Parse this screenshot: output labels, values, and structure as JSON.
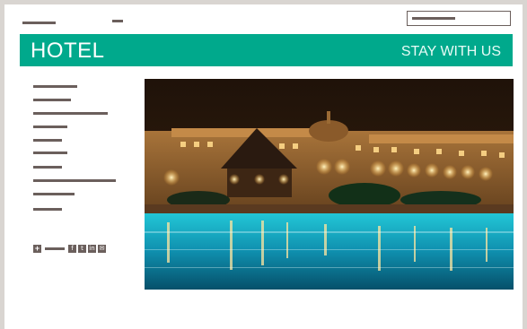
{
  "header": {
    "brand": "HOTEL",
    "tagline": "STAY WITH US",
    "brand_color": "#00a98c"
  },
  "placeholder_color": "#6b5f5c",
  "social": {
    "icons": [
      "plus-icon",
      "facebook-icon",
      "twitter-icon",
      "linkedin-icon",
      "email-icon"
    ],
    "glyphs": {
      "plus": "+",
      "facebook": "f",
      "twitter": "t",
      "linkedin": "in",
      "email": "✉"
    }
  },
  "hero": {
    "description_icon": "hotel-pool-night-photo"
  }
}
